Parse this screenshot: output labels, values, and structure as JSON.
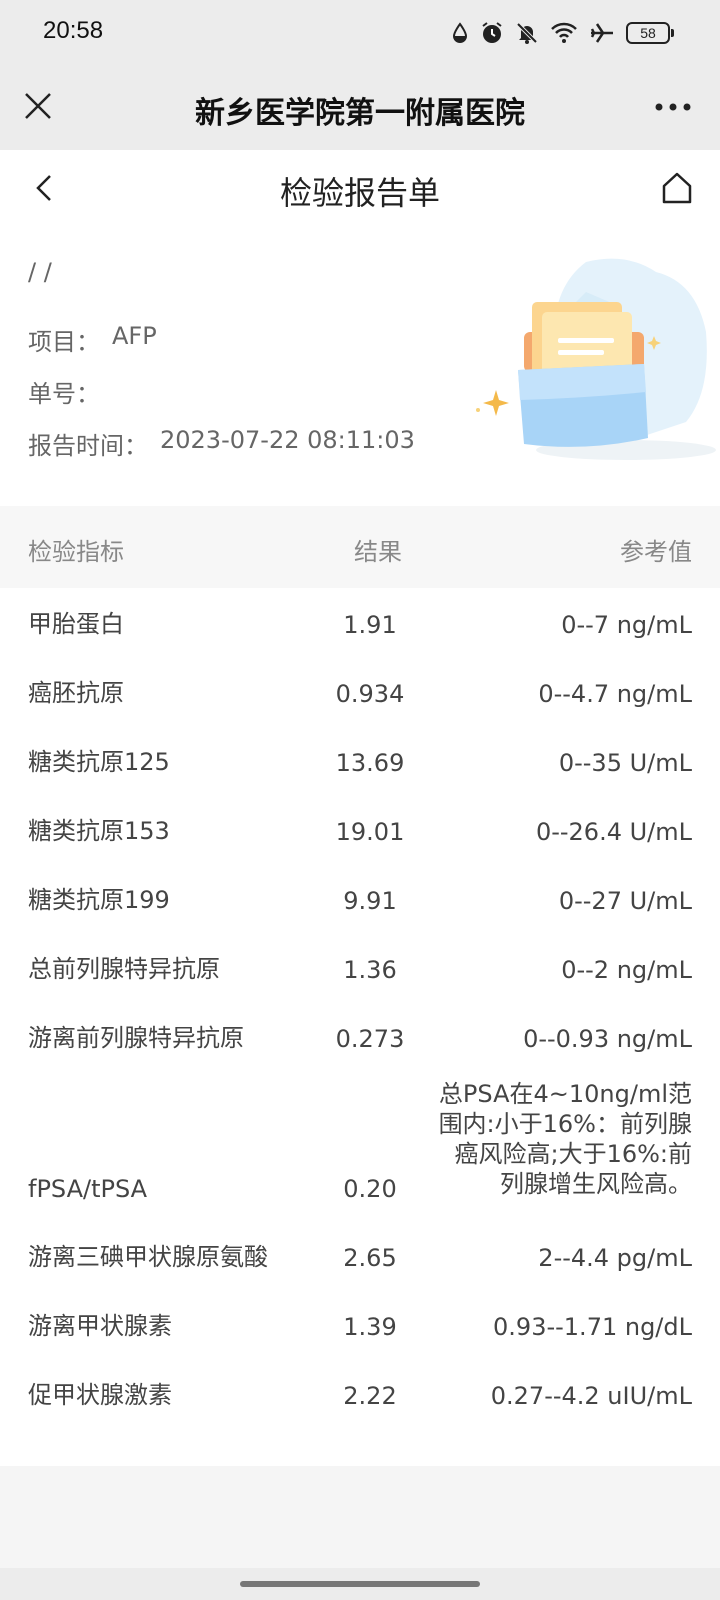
{
  "status_bar": {
    "time": "20:58",
    "battery": "58",
    "icons": [
      "data-saver-icon",
      "alarm-icon",
      "bell-off-icon",
      "wifi-icon",
      "airplane-icon",
      "battery-icon"
    ]
  },
  "navbar": {
    "title": "新乡医学院第一附属医院",
    "close_icon": "close-icon",
    "more_icon": "more-icon"
  },
  "subheader": {
    "title": "检验报告单",
    "back_icon": "chevron-left-icon",
    "home_icon": "home-icon"
  },
  "info": {
    "patient": "/ /",
    "item_label": "项目：",
    "item_value": "AFP",
    "order_label": "单号：",
    "order_value": "",
    "time_label": "报告时间：",
    "time_value": "2023-07-22 08:11:03"
  },
  "table": {
    "headers": {
      "name": "检验指标",
      "result": "结果",
      "ref": "参考值"
    },
    "rows": [
      {
        "name": "甲胎蛋白",
        "result": "1.91",
        "ref": "0--7 ng/mL"
      },
      {
        "name": "癌胚抗原",
        "result": "0.934",
        "ref": "0--4.7 ng/mL"
      },
      {
        "name": "糖类抗原125",
        "result": "13.69",
        "ref": "0--35 U/mL"
      },
      {
        "name": "糖类抗原153",
        "result": "19.01",
        "ref": "0--26.4 U/mL"
      },
      {
        "name": "糖类抗原199",
        "result": "9.91",
        "ref": "0--27 U/mL"
      },
      {
        "name": "总前列腺特异抗原",
        "result": "1.36",
        "ref": "0--2 ng/mL"
      },
      {
        "name": "游离前列腺特异抗原",
        "result": "0.273",
        "ref": "0--0.93 ng/mL"
      },
      {
        "name": "fPSA/tPSA",
        "result": "0.20",
        "ref": "总PSA在4~10ng/ml范围内:小于16%：前列腺癌风险高;大于16%:前列腺增生风险高。"
      },
      {
        "name": "游离三碘甲状腺原氨酸",
        "result": "2.65",
        "ref": "2--4.4 pg/mL"
      },
      {
        "name": "游离甲状腺素",
        "result": "1.39",
        "ref": "0.93--1.71 ng/dL"
      },
      {
        "name": "促甲状腺激素",
        "result": "2.22",
        "ref": "0.27--4.2 uIU/mL"
      }
    ]
  }
}
